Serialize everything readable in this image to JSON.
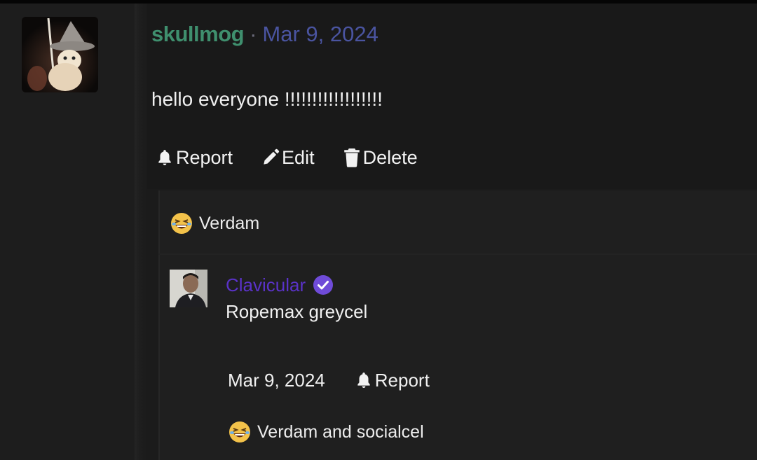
{
  "post": {
    "username": "skullmog",
    "separator": "·",
    "date": "Mar 9, 2024",
    "body": "hello everyone !!!!!!!!!!!!!!!!!!",
    "actions": {
      "report": "Report",
      "edit": "Edit",
      "delete": "Delete"
    }
  },
  "reactions": [
    {
      "emoji": "grinning-squinting-emoji",
      "text": "Verdam"
    }
  ],
  "reply": {
    "username": "Clavicular",
    "verified": true,
    "text": "Ropemax greycel",
    "date": "Mar 9, 2024",
    "report": "Report",
    "reaction": {
      "emoji": "grinning-squinting-emoji",
      "text": "Verdam and socialcel"
    }
  },
  "colors": {
    "username": "#3f8f6e",
    "date": "#4a54a0",
    "reply_username": "#5a32c8",
    "verified_badge": "#6f4bd8",
    "background": "#1b1b1b"
  }
}
